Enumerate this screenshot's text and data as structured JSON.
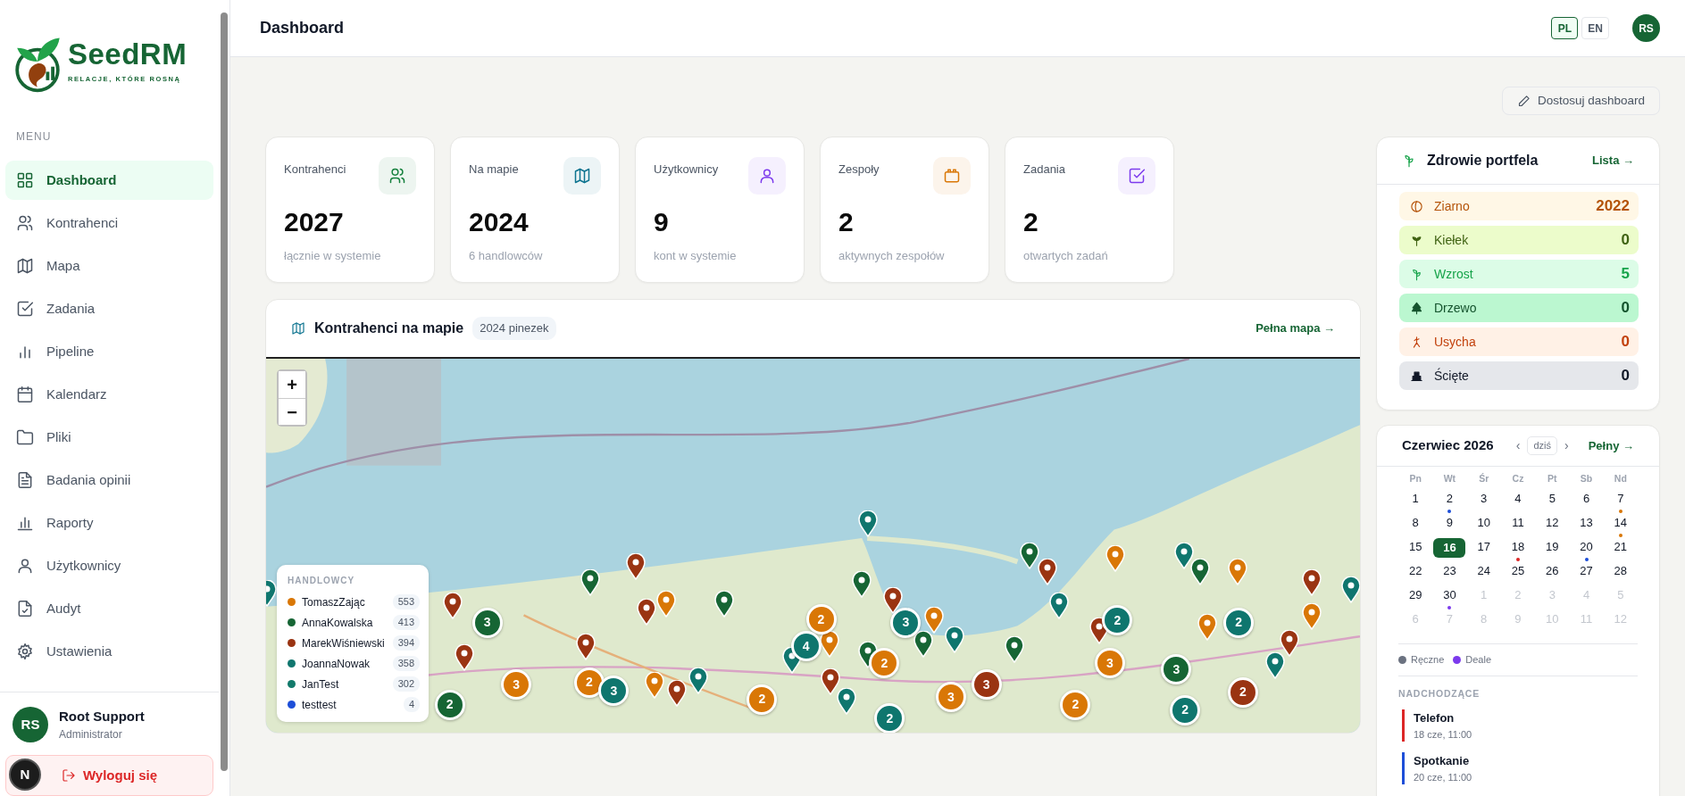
{
  "header": {
    "title": "Dashboard",
    "languages": [
      {
        "label": "PL",
        "selected": true
      },
      {
        "label": "EN",
        "selected": false
      }
    ],
    "avatar": "RS"
  },
  "sidebar": {
    "logo": {
      "name": "SeedRM",
      "tagline": "RELACJE, KTÓRE ROSNĄ"
    },
    "menu_label": "MENU",
    "items": [
      {
        "label": "Dashboard",
        "selected": true
      },
      {
        "label": "Kontrahenci",
        "selected": false
      },
      {
        "label": "Mapa",
        "selected": false
      },
      {
        "label": "Zadania",
        "selected": false
      },
      {
        "label": "Pipeline",
        "selected": false
      },
      {
        "label": "Kalendarz",
        "selected": false
      },
      {
        "label": "Pliki",
        "selected": false
      },
      {
        "label": "Badania opinii",
        "selected": false
      },
      {
        "label": "Raporty",
        "selected": false
      },
      {
        "label": "Użytkownicy",
        "selected": false
      },
      {
        "label": "Audyt",
        "selected": false
      },
      {
        "label": "Ustawienia",
        "selected": false
      }
    ],
    "user": {
      "initials": "RS",
      "name": "Root Support",
      "role": "Administrator"
    },
    "logout": "Wyloguj się",
    "dev_badge": "N"
  },
  "toolbar": {
    "customize": "Dostosuj dashboard"
  },
  "stats": [
    {
      "label": "Kontrahenci",
      "value": "2027",
      "note": "łącznie w systemie",
      "color": "#15803d"
    },
    {
      "label": "Na mapie",
      "value": "2024",
      "note": "6 handlowców",
      "color": "#0e7490"
    },
    {
      "label": "Użytkownicy",
      "value": "9",
      "note": "kont w systemie",
      "color": "#7c3aed"
    },
    {
      "label": "Zespoły",
      "value": "2",
      "note": "aktywnych zespołów",
      "color": "#d97706"
    },
    {
      "label": "Zadania",
      "value": "2",
      "note": "otwartych zadań",
      "color": "#7c3aed"
    }
  ],
  "map": {
    "title": "Kontrahenci na mapie",
    "badge": "2024 pinezek",
    "link": "Pełna mapa →",
    "zoom_in": "+",
    "zoom_out": "−",
    "legend": {
      "title": "HANDLOWCY",
      "items": [
        {
          "name": "TomaszZając",
          "count": "553",
          "color": "#d97706"
        },
        {
          "name": "AnnaKowalska",
          "count": "413",
          "color": "#166534"
        },
        {
          "name": "MarekWiśniewski",
          "count": "394",
          "color": "#9a3412"
        },
        {
          "name": "JoannaNowak",
          "count": "358",
          "color": "#0f766e"
        },
        {
          "name": "JanTest",
          "count": "302",
          "color": "#127a6b"
        },
        {
          "name": "testtest",
          "count": "4",
          "color": "#1d4ed8"
        }
      ]
    },
    "clusters": [
      {
        "count": "3",
        "color": "#166534"
      },
      {
        "count": "2",
        "color": "#d97706"
      },
      {
        "count": "3",
        "color": "#0f766e"
      },
      {
        "count": "2",
        "color": "#0f766e"
      },
      {
        "count": "2",
        "color": "#0f766e"
      },
      {
        "count": "4",
        "color": "#0f766e"
      },
      {
        "count": "3",
        "color": "#d97706"
      },
      {
        "count": "2",
        "color": "#d97706"
      },
      {
        "count": "3",
        "color": "#0f766e"
      },
      {
        "count": "2",
        "color": "#d97706"
      },
      {
        "count": "3",
        "color": "#d97706"
      },
      {
        "count": "3",
        "color": "#166534"
      },
      {
        "count": "2",
        "color": "#166534"
      },
      {
        "count": "2",
        "color": "#d97706"
      },
      {
        "count": "3",
        "color": "#d97706"
      },
      {
        "count": "3",
        "color": "#9a3412"
      },
      {
        "count": "2",
        "color": "#d97706"
      },
      {
        "count": "2",
        "color": "#0f766e"
      },
      {
        "count": "2",
        "color": "#9a3412"
      },
      {
        "count": "2",
        "color": "#0f766e"
      }
    ]
  },
  "portfolio": {
    "title": "Zdrowie portfela",
    "link": "Lista →",
    "rows": [
      {
        "kind": "seed",
        "label": "Ziarno",
        "count": "2022",
        "color": "#b45309"
      },
      {
        "kind": "sprout",
        "label": "Kiełek",
        "count": "0",
        "color": "#3f6212"
      },
      {
        "kind": "growth",
        "label": "Wzrost",
        "count": "5",
        "color": "#16a34a"
      },
      {
        "kind": "tree",
        "label": "Drzewo",
        "count": "0",
        "color": "#14532d"
      },
      {
        "kind": "wither",
        "label": "Usycha",
        "count": "0",
        "color": "#c2410c"
      },
      {
        "kind": "cut",
        "label": "Ścięte",
        "count": "0",
        "color": "#111827"
      }
    ]
  },
  "calendar": {
    "title": "Czerwiec 2026",
    "prev": "‹",
    "today": "dziś",
    "next": "›",
    "link": "Pełny →",
    "weekdays": [
      "Pn",
      "Wt",
      "Śr",
      "Cz",
      "Pt",
      "Sb",
      "Nd"
    ],
    "days": [
      {
        "label": "1",
        "outside": false,
        "selected": false
      },
      {
        "label": "2",
        "outside": false,
        "selected": false,
        "color": "#1d4ed8"
      },
      {
        "label": "3",
        "outside": false,
        "selected": false
      },
      {
        "label": "4",
        "outside": false,
        "selected": false
      },
      {
        "label": "5",
        "outside": false,
        "selected": false
      },
      {
        "label": "6",
        "outside": false,
        "selected": false
      },
      {
        "label": "7",
        "outside": false,
        "selected": false,
        "color": "#d97706"
      },
      {
        "label": "8",
        "outside": false,
        "selected": false
      },
      {
        "label": "9",
        "outside": false,
        "selected": false
      },
      {
        "label": "10",
        "outside": false,
        "selected": false
      },
      {
        "label": "11",
        "outside": false,
        "selected": false
      },
      {
        "label": "12",
        "outside": false,
        "selected": false
      },
      {
        "label": "13",
        "outside": false,
        "selected": false
      },
      {
        "label": "14",
        "outside": false,
        "selected": false,
        "color": "#d97706"
      },
      {
        "label": "15",
        "outside": false,
        "selected": false
      },
      {
        "label": "16",
        "outside": false,
        "selected": true
      },
      {
        "label": "17",
        "outside": false,
        "selected": false
      },
      {
        "label": "18",
        "outside": false,
        "selected": false,
        "color": "#dc2626"
      },
      {
        "label": "19",
        "outside": false,
        "selected": false
      },
      {
        "label": "20",
        "outside": false,
        "selected": false,
        "color": "#1d4ed8"
      },
      {
        "label": "21",
        "outside": false,
        "selected": false
      },
      {
        "label": "22",
        "outside": false,
        "selected": false
      },
      {
        "label": "23",
        "outside": false,
        "selected": false
      },
      {
        "label": "24",
        "outside": false,
        "selected": false
      },
      {
        "label": "25",
        "outside": false,
        "selected": false
      },
      {
        "label": "26",
        "outside": false,
        "selected": false
      },
      {
        "label": "27",
        "outside": false,
        "selected": false
      },
      {
        "label": "28",
        "outside": false,
        "selected": false
      },
      {
        "label": "29",
        "outside": false,
        "selected": false
      },
      {
        "label": "30",
        "outside": false,
        "selected": false,
        "color": "#7c3aed"
      },
      {
        "label": "1",
        "outside": true,
        "selected": false
      },
      {
        "label": "2",
        "outside": true,
        "selected": false
      },
      {
        "label": "3",
        "outside": true,
        "selected": false
      },
      {
        "label": "4",
        "outside": true,
        "selected": false
      },
      {
        "label": "5",
        "outside": true,
        "selected": false
      },
      {
        "label": "6",
        "outside": true,
        "selected": false
      },
      {
        "label": "7",
        "outside": true,
        "selected": false
      },
      {
        "label": "8",
        "outside": true,
        "selected": false
      },
      {
        "label": "9",
        "outside": true,
        "selected": false
      },
      {
        "label": "10",
        "outside": true,
        "selected": false
      },
      {
        "label": "11",
        "outside": true,
        "selected": false
      },
      {
        "label": "12",
        "outside": true,
        "selected": false
      }
    ],
    "legend": [
      {
        "label": "Ręczne",
        "color": "#6b7280"
      },
      {
        "label": "Deale",
        "color": "#7c3aed"
      }
    ],
    "upcoming_label": "NADCHODZĄCE",
    "upcoming": [
      {
        "title": "Telefon",
        "time": "18 cze, 11:00",
        "color": "#dc2626"
      },
      {
        "title": "Spotkanie",
        "time": "20 cze, 11:00",
        "color": "#1d4ed8"
      }
    ]
  }
}
